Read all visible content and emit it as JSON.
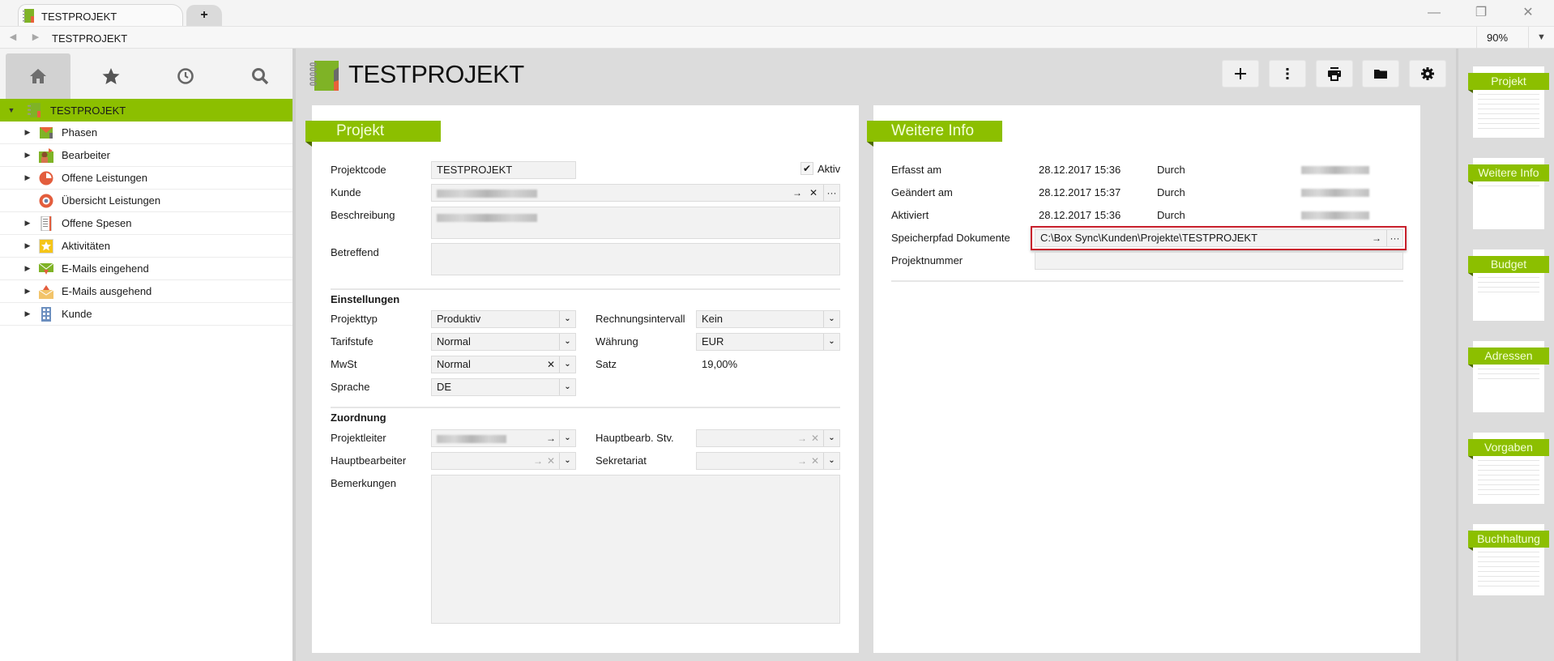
{
  "window": {
    "tab_title": "TESTPROJEKT",
    "new_tab_label": "+",
    "address": "TESTPROJEKT",
    "zoom_level": "90%",
    "controls": {
      "minimize": "—",
      "restore": "❐",
      "close": "✕"
    }
  },
  "sidebar": {
    "nav_tabs": [
      {
        "name": "home",
        "icon": "home-icon",
        "active": true
      },
      {
        "name": "favorites",
        "icon": "star-icon",
        "active": false
      },
      {
        "name": "recent",
        "icon": "clock-icon",
        "active": false
      },
      {
        "name": "search",
        "icon": "search-icon",
        "active": false
      }
    ],
    "root": {
      "label": "TESTPROJEKT",
      "expanded": true
    },
    "items": [
      {
        "label": "Phasen",
        "icon": "phases-icon",
        "expandable": true
      },
      {
        "label": "Bearbeiter",
        "icon": "users-icon",
        "expandable": true
      },
      {
        "label": "Offene Leistungen",
        "icon": "pie-chart-icon",
        "expandable": true
      },
      {
        "label": "Übersicht Leistungen",
        "icon": "target-icon",
        "expandable": false
      },
      {
        "label": "Offene Spesen",
        "icon": "receipt-icon",
        "expandable": true
      },
      {
        "label": "Aktivitäten",
        "icon": "star-badge-icon",
        "expandable": true
      },
      {
        "label": "E-Mails eingehend",
        "icon": "mail-in-icon",
        "expandable": true
      },
      {
        "label": "E-Mails ausgehend",
        "icon": "mail-out-icon",
        "expandable": true
      },
      {
        "label": "Kunde",
        "icon": "building-icon",
        "expandable": true
      }
    ]
  },
  "header": {
    "title": "TESTPROJEKT",
    "toolbar": [
      {
        "name": "add",
        "icon": "plus-icon"
      },
      {
        "name": "more",
        "icon": "more-vertical-icon"
      },
      {
        "name": "print",
        "icon": "printer-icon"
      },
      {
        "name": "folder",
        "icon": "folder-icon"
      },
      {
        "name": "settings",
        "icon": "gear-icon"
      }
    ]
  },
  "projekt": {
    "title": "Projekt",
    "projektcode_label": "Projektcode",
    "projektcode_value": "TESTPROJEKT",
    "aktiv_label": "Aktiv",
    "aktiv_checked": true,
    "kunde_label": "Kunde",
    "kunde_value": "(blurred)",
    "beschreibung_label": "Beschreibung",
    "beschreibung_value": "(blurred)",
    "betreffend_label": "Betreffend",
    "betreffend_value": "",
    "einstellungen": {
      "heading": "Einstellungen",
      "projekttyp_label": "Projekttyp",
      "projekttyp_value": "Produktiv",
      "tarifstufe_label": "Tarifstufe",
      "tarifstufe_value": "Normal",
      "mwst_label": "MwSt",
      "mwst_value": "Normal",
      "sprache_label": "Sprache",
      "sprache_value": "DE",
      "rechnungsintervall_label": "Rechnungsintervall",
      "rechnungsintervall_value": "Kein",
      "waehrung_label": "Währung",
      "waehrung_value": "EUR",
      "satz_label": "Satz",
      "satz_value": "19,00%"
    },
    "zuordnung": {
      "heading": "Zuordnung",
      "projektleiter_label": "Projektleiter",
      "projektleiter_value": "(blurred)",
      "hauptbearbeiter_label": "Hauptbearbeiter",
      "hauptbearbeiter_value": "",
      "hauptbearb_stv_label": "Hauptbearb. Stv.",
      "hauptbearb_stv_value": "",
      "sekretariat_label": "Sekretariat",
      "sekretariat_value": "",
      "bemerkungen_label": "Bemerkungen",
      "bemerkungen_value": ""
    }
  },
  "weitere_info": {
    "title": "Weitere Info",
    "rows": [
      {
        "label": "Erfasst am",
        "value": "28.12.2017 15:36",
        "by_label": "Durch",
        "by_value": "(blurred)"
      },
      {
        "label": "Geändert am",
        "value": "28.12.2017 15:37",
        "by_label": "Durch",
        "by_value": "(blurred)"
      },
      {
        "label": "Aktiviert",
        "value": "28.12.2017 15:36",
        "by_label": "Durch",
        "by_value": "(blurred)"
      }
    ],
    "speicherpfad_label": "Speicherpfad Dokumente",
    "speicherpfad_value": "C:\\Box Sync\\Kunden\\Projekte\\TESTPROJEKT",
    "projektnummer_label": "Projektnummer",
    "projektnummer_value": ""
  },
  "thumbnails": [
    "Projekt",
    "Weitere Info",
    "Budget",
    "Adressen",
    "Vorgaben",
    "Buchhaltung"
  ],
  "glyphs": {
    "arrow": "→",
    "clear": "✕",
    "more": "···",
    "chevron": "⌄",
    "caret_right": "▶",
    "caret_down": "▼",
    "check": "✔"
  },
  "colors": {
    "accent_green": "#8cbf00",
    "highlight_red": "#c8202c"
  }
}
